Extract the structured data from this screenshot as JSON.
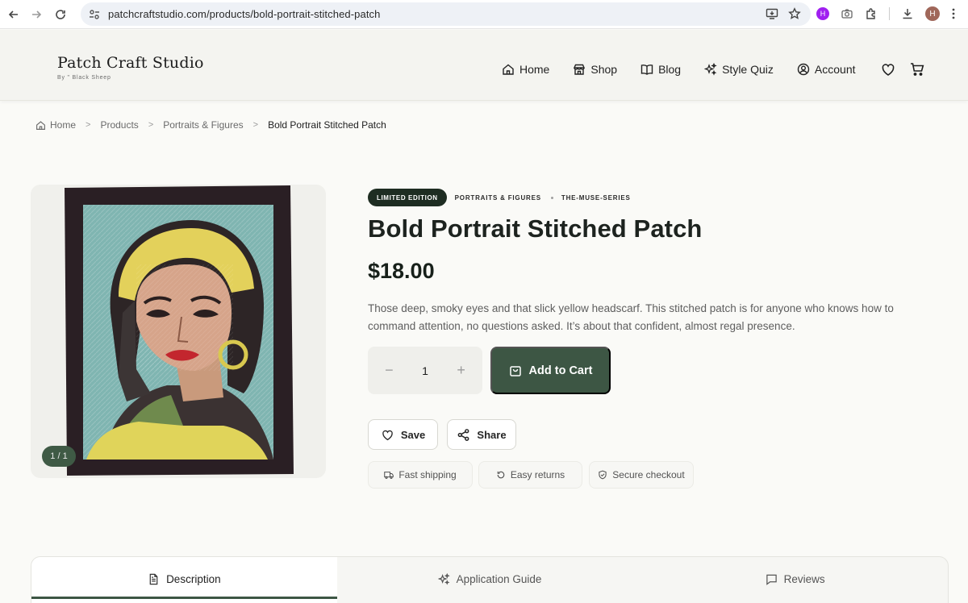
{
  "browser": {
    "url": "patchcraftstudio.com/products/bold-portrait-stitched-patch",
    "profile_initial": "H"
  },
  "site": {
    "brand_name": "Patch Craft Studio",
    "brand_sub": "By \" Black Sheep",
    "nav": {
      "home": "Home",
      "shop": "Shop",
      "blog": "Blog",
      "style_quiz": "Style Quiz",
      "account": "Account"
    }
  },
  "breadcrumb": {
    "home": "Home",
    "products": "Products",
    "category": "Portraits & Figures",
    "current": "Bold Portrait Stitched Patch"
  },
  "gallery": {
    "counter": "1 / 1"
  },
  "product": {
    "badge": "LIMITED EDITION",
    "category_tag": "PORTRAITS & FIGURES",
    "series_tag": "THE-MUSE-SERIES",
    "title": "Bold Portrait Stitched Patch",
    "price": "$18.00",
    "description": "Those deep, smoky eyes and that slick yellow headscarf. This stitched patch is for anyone who knows how to command attention, no questions asked. It’s about that confident, almost regal presence.",
    "quantity": "1",
    "qty_minus": "−",
    "qty_plus": "+",
    "add_to_cart": "Add to Cart",
    "save": "Save",
    "share": "Share",
    "features": {
      "shipping": "Fast shipping",
      "returns": "Easy returns",
      "secure": "Secure checkout"
    }
  },
  "tabs": {
    "description": "Description",
    "guide": "Application Guide",
    "reviews": "Reviews"
  },
  "colors": {
    "accent": "#3d5644",
    "badge": "#1e2d22",
    "page_bg": "#fafaf7"
  }
}
